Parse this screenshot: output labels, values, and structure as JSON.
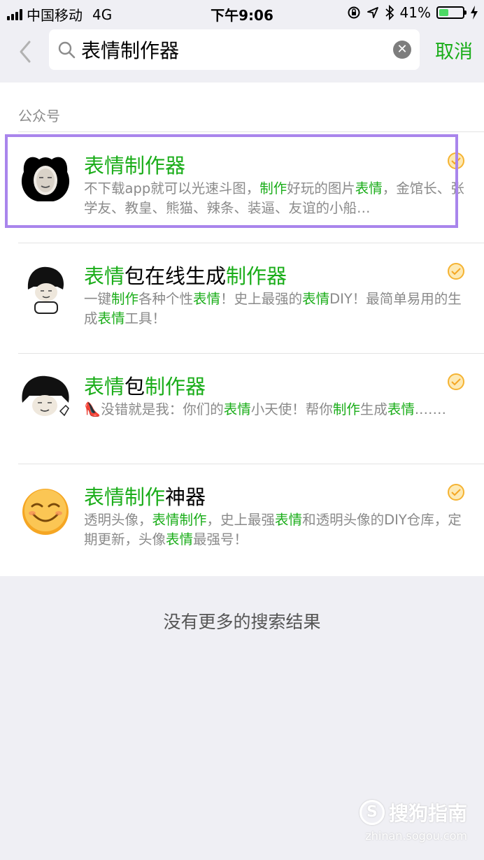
{
  "status_bar": {
    "carrier": "中国移动",
    "network": "4G",
    "time": "下午9:06",
    "battery_percent": "41%",
    "battery_level": 0.41
  },
  "search": {
    "query": "表情制作器",
    "cancel_label": "取消"
  },
  "section": {
    "title": "公众号"
  },
  "results": [
    {
      "title_parts": [
        {
          "t": "表情制作器",
          "hl": true
        }
      ],
      "desc_parts": [
        {
          "t": "不下载app就可以光速斗图，",
          "hl": false
        },
        {
          "t": "制作",
          "hl": true
        },
        {
          "t": "好玩的图片",
          "hl": false
        },
        {
          "t": "表情",
          "hl": true
        },
        {
          "t": "，金馆长、张学友、教皇、熊猫、辣条、装逼、友谊的小船…",
          "hl": false
        }
      ]
    },
    {
      "title_parts": [
        {
          "t": "表情",
          "hl": true
        },
        {
          "t": "包在线生成",
          "hl": false
        },
        {
          "t": "制作器",
          "hl": true
        }
      ],
      "desc_parts": [
        {
          "t": "一键",
          "hl": false
        },
        {
          "t": "制作",
          "hl": true
        },
        {
          "t": "各种个性",
          "hl": false
        },
        {
          "t": "表情",
          "hl": true
        },
        {
          "t": "！史上最强的",
          "hl": false
        },
        {
          "t": "表情",
          "hl": true
        },
        {
          "t": "DIY！最简单易用的生成",
          "hl": false
        },
        {
          "t": "表情",
          "hl": true
        },
        {
          "t": "工具！",
          "hl": false
        }
      ]
    },
    {
      "title_parts": [
        {
          "t": "表情",
          "hl": true
        },
        {
          "t": "包",
          "hl": false
        },
        {
          "t": "制作器",
          "hl": true
        }
      ],
      "desc_parts": [
        {
          "t": "👠没错就是我：你们的",
          "hl": false
        },
        {
          "t": "表情",
          "hl": true
        },
        {
          "t": "小天使！帮你",
          "hl": false
        },
        {
          "t": "制作",
          "hl": true
        },
        {
          "t": "生成",
          "hl": false
        },
        {
          "t": "表情",
          "hl": true
        },
        {
          "t": ".……",
          "hl": false
        }
      ]
    },
    {
      "title_parts": [
        {
          "t": "表情制作",
          "hl": true
        },
        {
          "t": "神器",
          "hl": false
        }
      ],
      "desc_parts": [
        {
          "t": "透明头像，",
          "hl": false
        },
        {
          "t": "表情制作",
          "hl": true
        },
        {
          "t": "，史上最强",
          "hl": false
        },
        {
          "t": "表情",
          "hl": true
        },
        {
          "t": "和透明头像的DIY仓库，定期更新，头像",
          "hl": false
        },
        {
          "t": "表情",
          "hl": true
        },
        {
          "t": "最强号！",
          "hl": false
        }
      ]
    }
  ],
  "footer": {
    "no_more": "没有更多的搜索结果"
  },
  "watermark": {
    "logo_letter": "S",
    "brand": "搜狗指南",
    "url": "zhinan.sogou.com"
  },
  "colors": {
    "accent": "#1aad19",
    "highlight_box": "#a985ec"
  }
}
